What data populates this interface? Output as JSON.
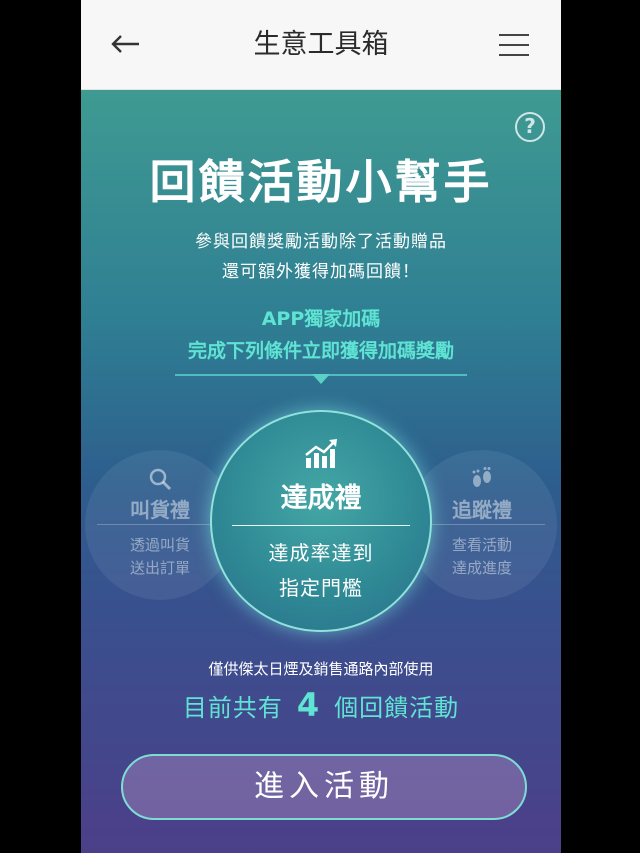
{
  "header": {
    "title": "生意工具箱",
    "back_icon": "back-arrow-icon",
    "menu_icon": "hamburger-menu-icon"
  },
  "help_icon": "?",
  "hero": {
    "headline": "回饋活動小幫手",
    "subtitle_line1": "參與回饋獎勵活動除了活動贈品",
    "subtitle_line2": "還可額外獲得加碼回饋！",
    "accent_line1": "APP獨家加碼",
    "accent_line2": "完成下列條件立即獲得加碼獎勵"
  },
  "rewards": {
    "left": {
      "icon": "search-icon",
      "label": "叫貨禮",
      "desc_line1": "透過叫貨",
      "desc_line2": "送出訂單"
    },
    "center": {
      "icon": "chart-growth-icon",
      "label": "達成禮",
      "desc_line1": "達成率達到",
      "desc_line2": "指定門檻"
    },
    "right": {
      "icon": "footprints-icon",
      "label": "追蹤禮",
      "desc_line1": "查看活動",
      "desc_line2": "達成進度"
    }
  },
  "footer": {
    "note": "僅供傑太日煙及銷售通路內部使用",
    "count_prefix": "目前共有",
    "count_value": "4",
    "count_suffix": "個回饋活動",
    "enter_button": "進入活動"
  },
  "colors": {
    "accent": "#5fe3d3",
    "gradient_top": "#3f9a92",
    "gradient_bottom": "#4c3f8a",
    "header_bg": "#f7f7f7"
  }
}
